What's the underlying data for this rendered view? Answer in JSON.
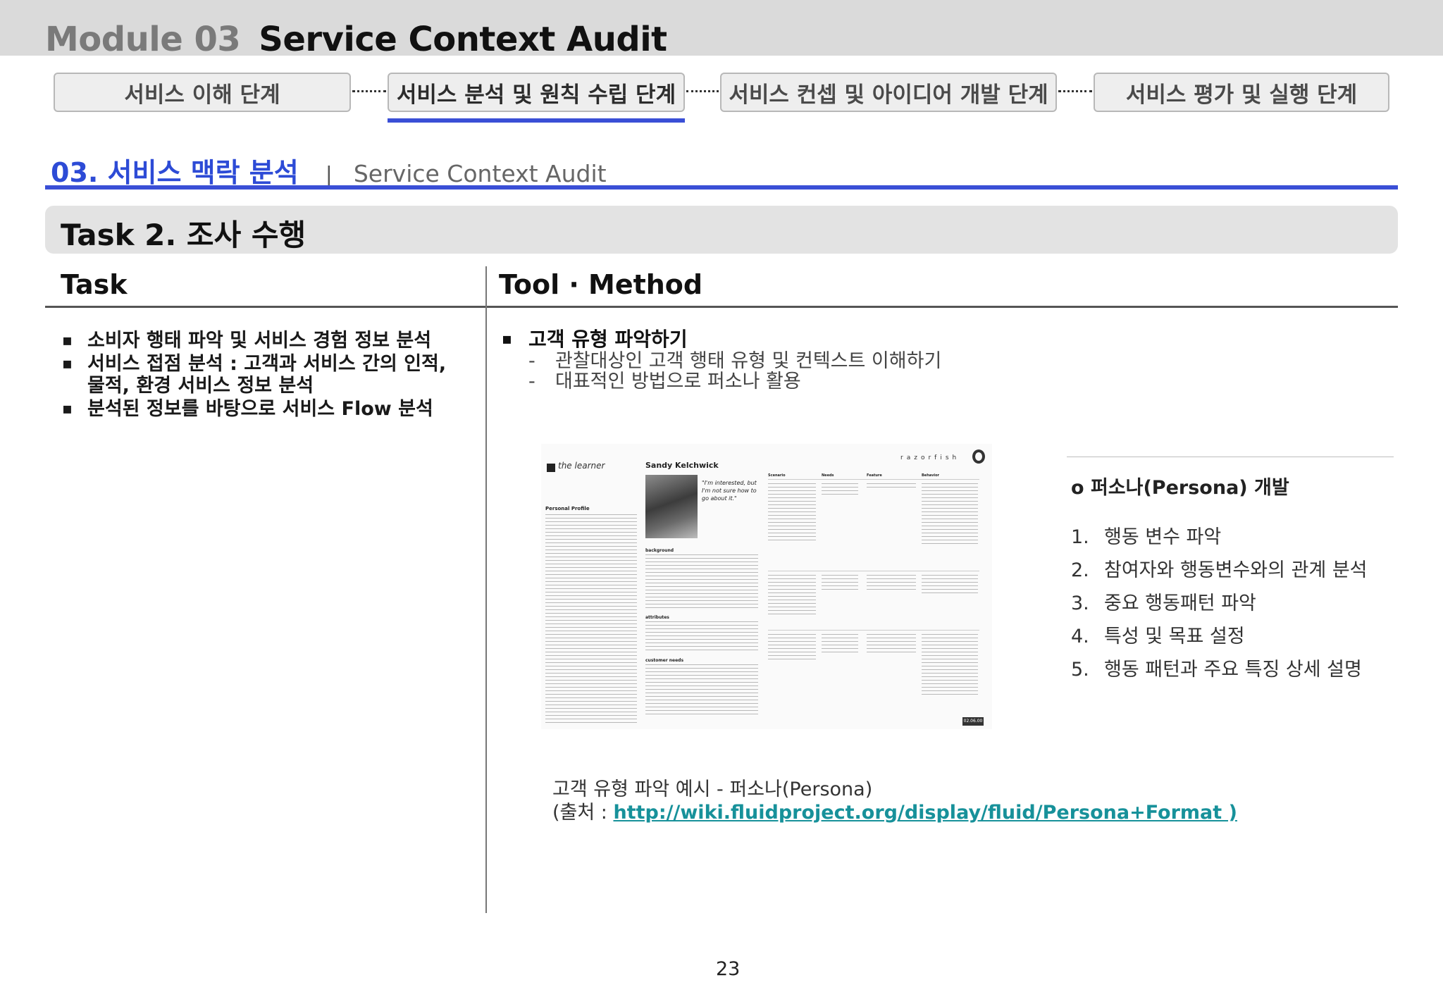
{
  "header": {
    "module_number": "Module 03",
    "module_title": "Service Context Audit"
  },
  "stages": [
    {
      "label": "서비스 이해 단계",
      "active": false
    },
    {
      "label": "서비스 분석 및 원칙 수립 단계",
      "active": true
    },
    {
      "label": "서비스 컨셉 및 아이디어 개발 단계",
      "active": false
    },
    {
      "label": "서비스 평가 및 실행 단계",
      "active": false
    }
  ],
  "section": {
    "number_title": "03. 서비스 맥락 분석",
    "separator": "|",
    "english_title": "Service Context Audit"
  },
  "task_bar": {
    "title": "Task 2. 조사 수행"
  },
  "columns": {
    "task_heading": "Task",
    "tool_heading": "Tool · Method"
  },
  "tasks": [
    "소비자 행태 파악 및 서비스 경험 정보 분석",
    "서비스 접점 분석 : 고객과 서비스 간의 인적, 물적, 환경 서비스 정보 분석",
    "분석된 정보를 바탕으로 서비스 Flow  분석"
  ],
  "tool": {
    "main": "고객 유형 파악하기",
    "subs": [
      "관찰대상인 고객 행태 유형 및 컨텍스트 이해하기",
      "대표적인 방법으로 퍼소나 활용"
    ]
  },
  "persona_image": {
    "learner": "the learner",
    "name": "Sandy Kelchwick",
    "quote": "\"I'm interested, but I'm not sure how to go about it.\"",
    "personal_profile": "Personal Profile",
    "background": "background",
    "attributes": "attributes",
    "customer_needs": "customer needs",
    "table_headers": [
      "Scenario",
      "Needs",
      "Feature",
      "Behavior"
    ],
    "brand": "razorfish",
    "page": "02.06.00"
  },
  "caption": {
    "line1": "고객 유형 파악 예시 - 퍼소나(Persona)",
    "source_prefix": "(출처 : ",
    "source_link": "http://wiki.fluidproject.org/display/fluid/Persona+Format )"
  },
  "persona_dev": {
    "title": "o  퍼소나(Persona) 개발",
    "steps": [
      {
        "num": "1.",
        "text": "행동 변수 파악"
      },
      {
        "num": "2.",
        "text": "참여자와 행동변수와의 관계 분석"
      },
      {
        "num": "3.",
        "text": "중요 행동패턴 파악"
      },
      {
        "num": "4.",
        "text": "특성 및 목표 설정"
      },
      {
        "num": "5.",
        "text": "행동 패턴과 주요 특징 상세 설명"
      }
    ]
  },
  "page_number": "23",
  "colors": {
    "accent_blue": "#3a4fd6",
    "link_teal": "#17919a",
    "top_bar_gray": "#dadada"
  }
}
